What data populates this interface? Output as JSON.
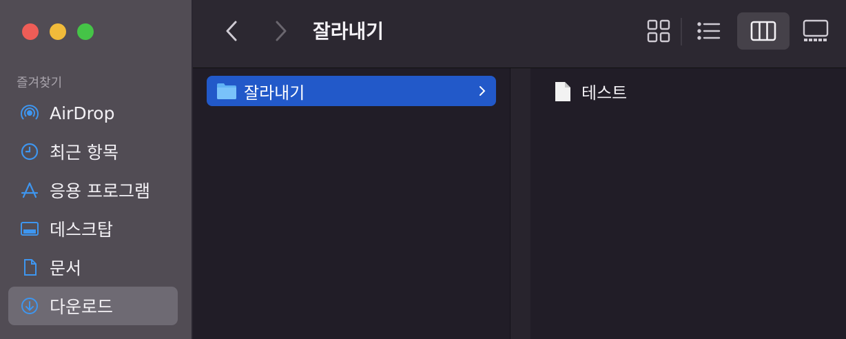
{
  "window": {
    "title": "잘라내기"
  },
  "sidebar": {
    "section_title": "즐겨찾기",
    "items": [
      {
        "label": "AirDrop",
        "icon": "airdrop-icon"
      },
      {
        "label": "최근 항목",
        "icon": "clock-icon"
      },
      {
        "label": "응용 프로그램",
        "icon": "applications-icon"
      },
      {
        "label": "데스크탑",
        "icon": "desktop-icon"
      },
      {
        "label": "문서",
        "icon": "document-icon"
      },
      {
        "label": "다운로드",
        "icon": "download-icon",
        "selected": true
      }
    ]
  },
  "toolbar": {
    "view_modes": [
      "icons",
      "list",
      "columns",
      "gallery"
    ],
    "active_view": "columns"
  },
  "columns": [
    {
      "items": [
        {
          "label": "잘라내기",
          "type": "folder",
          "selected": true
        }
      ]
    },
    {
      "items": [
        {
          "label": "테스트",
          "type": "file"
        }
      ]
    }
  ],
  "colors": {
    "accent": "#2259c9",
    "sidebar_bg": "#514c54",
    "content_bg": "#211d27",
    "icon_blue": "#3e96f0"
  }
}
